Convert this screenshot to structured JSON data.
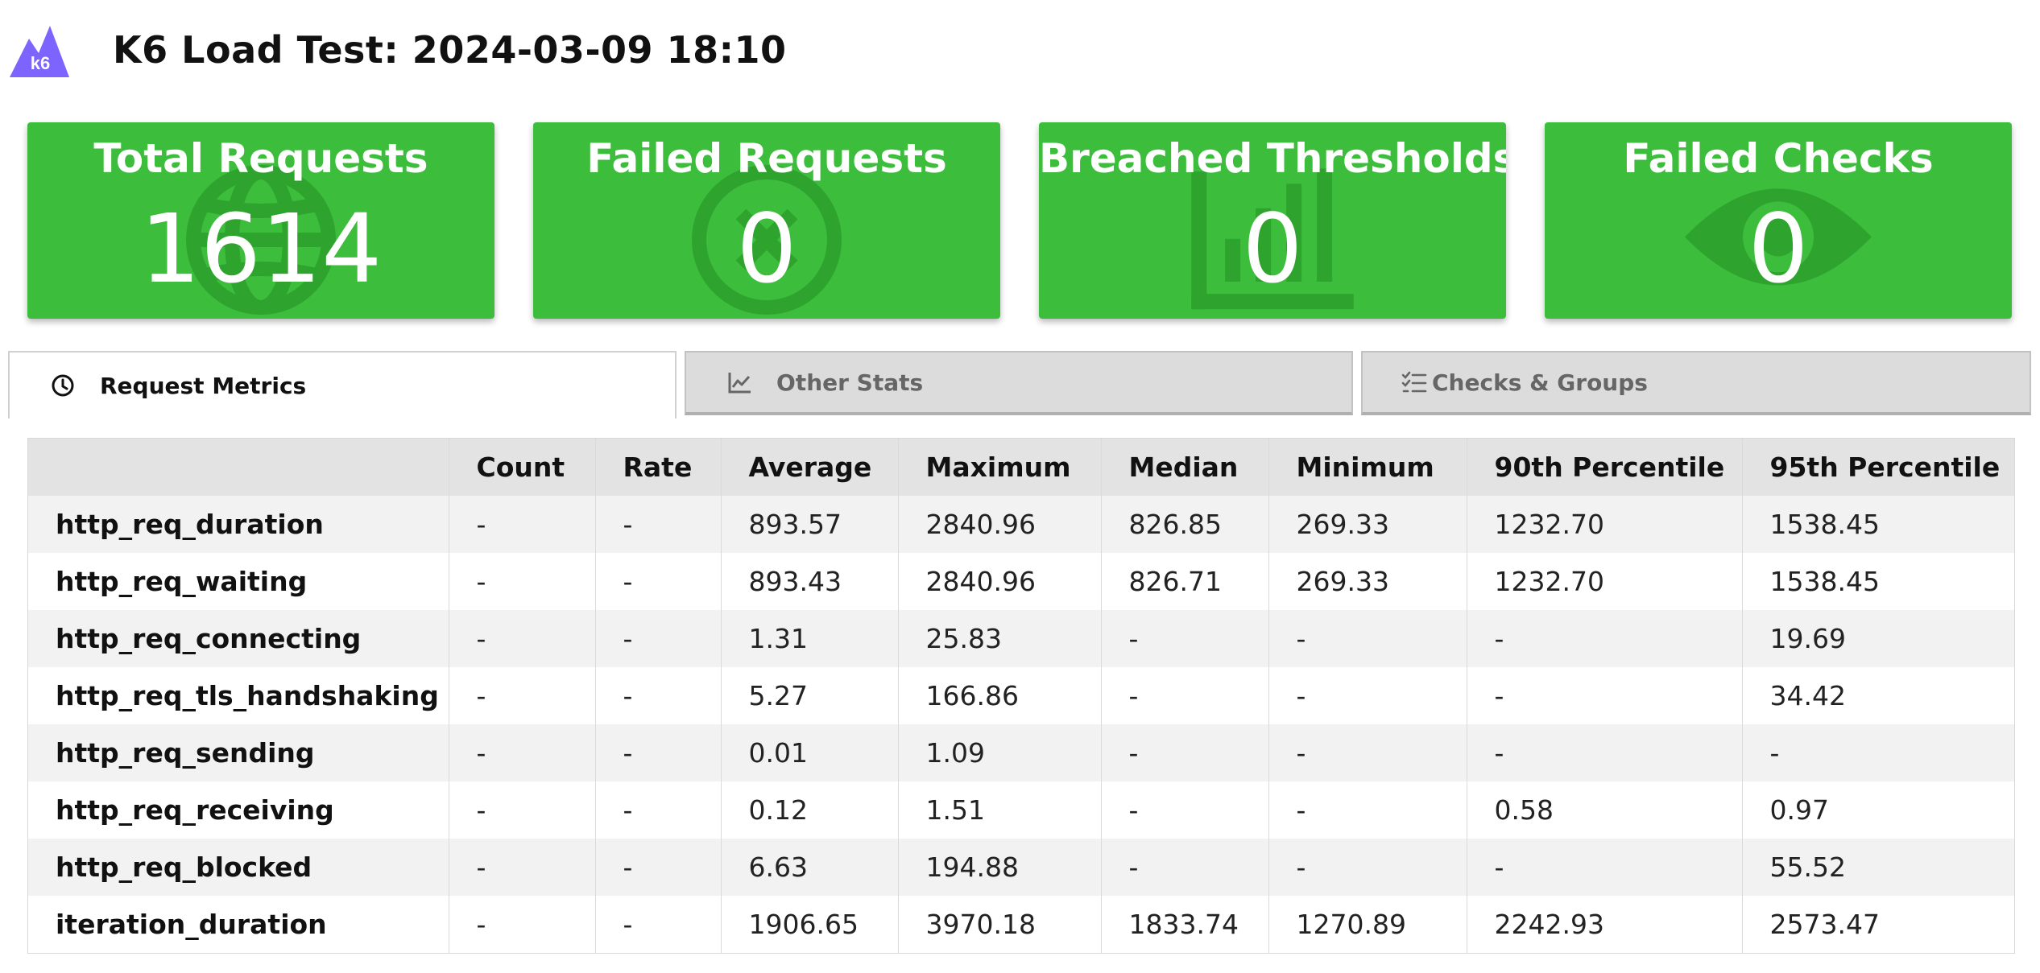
{
  "header": {
    "logo_text": "k6",
    "title": "K6 Load Test: 2024-03-09 18:10"
  },
  "cards": [
    {
      "title": "Total Requests",
      "value": "1614",
      "icon": "globe-icon"
    },
    {
      "title": "Failed Requests",
      "value": "0",
      "icon": "x-circle-icon"
    },
    {
      "title": "Breached Thresholds",
      "value": "0",
      "icon": "bar-chart-icon"
    },
    {
      "title": "Failed Checks",
      "value": "0",
      "icon": "eye-icon"
    }
  ],
  "colors": {
    "card_green": "#3cbd3c",
    "logo_purple": "#7d64ff"
  },
  "tabs": [
    {
      "label": "Request Metrics",
      "icon": "clock-icon",
      "active": true
    },
    {
      "label": "Other Stats",
      "icon": "line-chart-icon",
      "active": false
    },
    {
      "label": "Checks & Groups",
      "icon": "checklist-icon",
      "active": false
    }
  ],
  "table": {
    "headers": [
      "",
      "Count",
      "Rate",
      "Average",
      "Maximum",
      "Median",
      "Minimum",
      "90th Percentile",
      "95th Percentile"
    ],
    "rows": [
      [
        "http_req_duration",
        "-",
        "-",
        "893.57",
        "2840.96",
        "826.85",
        "269.33",
        "1232.70",
        "1538.45"
      ],
      [
        "http_req_waiting",
        "-",
        "-",
        "893.43",
        "2840.96",
        "826.71",
        "269.33",
        "1232.70",
        "1538.45"
      ],
      [
        "http_req_connecting",
        "-",
        "-",
        "1.31",
        "25.83",
        "-",
        "-",
        "-",
        "19.69"
      ],
      [
        "http_req_tls_handshaking",
        "-",
        "-",
        "5.27",
        "166.86",
        "-",
        "-",
        "-",
        "34.42"
      ],
      [
        "http_req_sending",
        "-",
        "-",
        "0.01",
        "1.09",
        "-",
        "-",
        "-",
        "-"
      ],
      [
        "http_req_receiving",
        "-",
        "-",
        "0.12",
        "1.51",
        "-",
        "-",
        "0.58",
        "0.97"
      ],
      [
        "http_req_blocked",
        "-",
        "-",
        "6.63",
        "194.88",
        "-",
        "-",
        "-",
        "55.52"
      ],
      [
        "iteration_duration",
        "-",
        "-",
        "1906.65",
        "3970.18",
        "1833.74",
        "1270.89",
        "2242.93",
        "2573.47"
      ]
    ]
  }
}
